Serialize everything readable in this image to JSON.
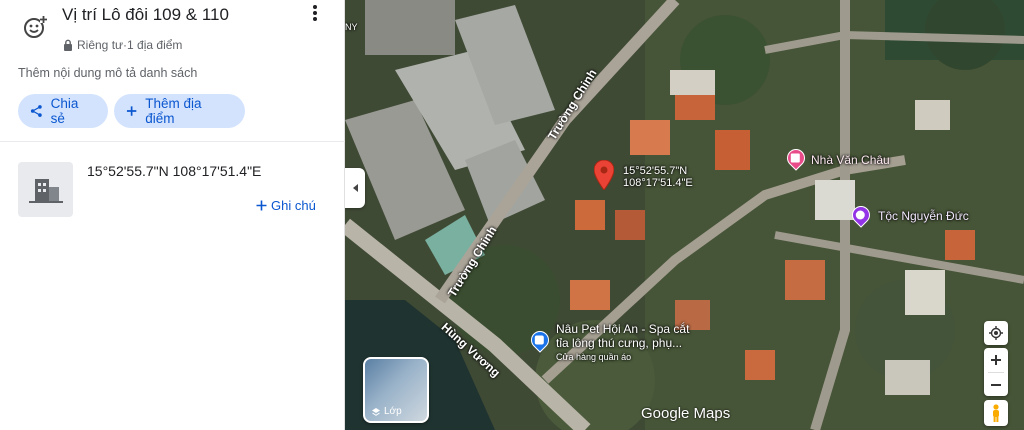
{
  "panel": {
    "title": "Vị trí Lô đôi 109 & 110",
    "privacy": "Riêng tư·1 địa điểm",
    "description": "Thêm nội dung mô tả danh sách",
    "share_label": "Chia sẻ",
    "add_place_label": "Thêm địa điểm",
    "place": {
      "name": "15°52'55.7\"N 108°17'51.4\"E",
      "note_label": "Ghi chú"
    }
  },
  "map": {
    "pin_label_line1": "15°52'55.7\"N",
    "pin_label_line2": "108°17'51.4\"E",
    "poi_nha_van_chau": "Nhà Văn Châu",
    "poi_toc_nguyen_duc": "Tộc Nguyễn Đức",
    "poi_pet_line1": "Nâu Pet Hội An - Spa cắt",
    "poi_pet_line2": "tỉa lông thú cưng, phụ...",
    "poi_pet_sub": "Cửa hàng quần áo",
    "street_truong_chinh_1": "Trường Chinh",
    "street_truong_chinh_2": "Trường Chinh",
    "street_hung_vuong": "Hùng Vương",
    "edge_label": "NY",
    "layers_label": "Lớp",
    "google_logo": "Google Maps",
    "colors": {
      "accent": "#0b57d0",
      "chip_bg": "#d3e3fd",
      "pin": "#ea4335",
      "poi_pink": "#e84d8a",
      "poi_purple": "#9334e6",
      "poi_blue": "#1a73e8"
    }
  }
}
